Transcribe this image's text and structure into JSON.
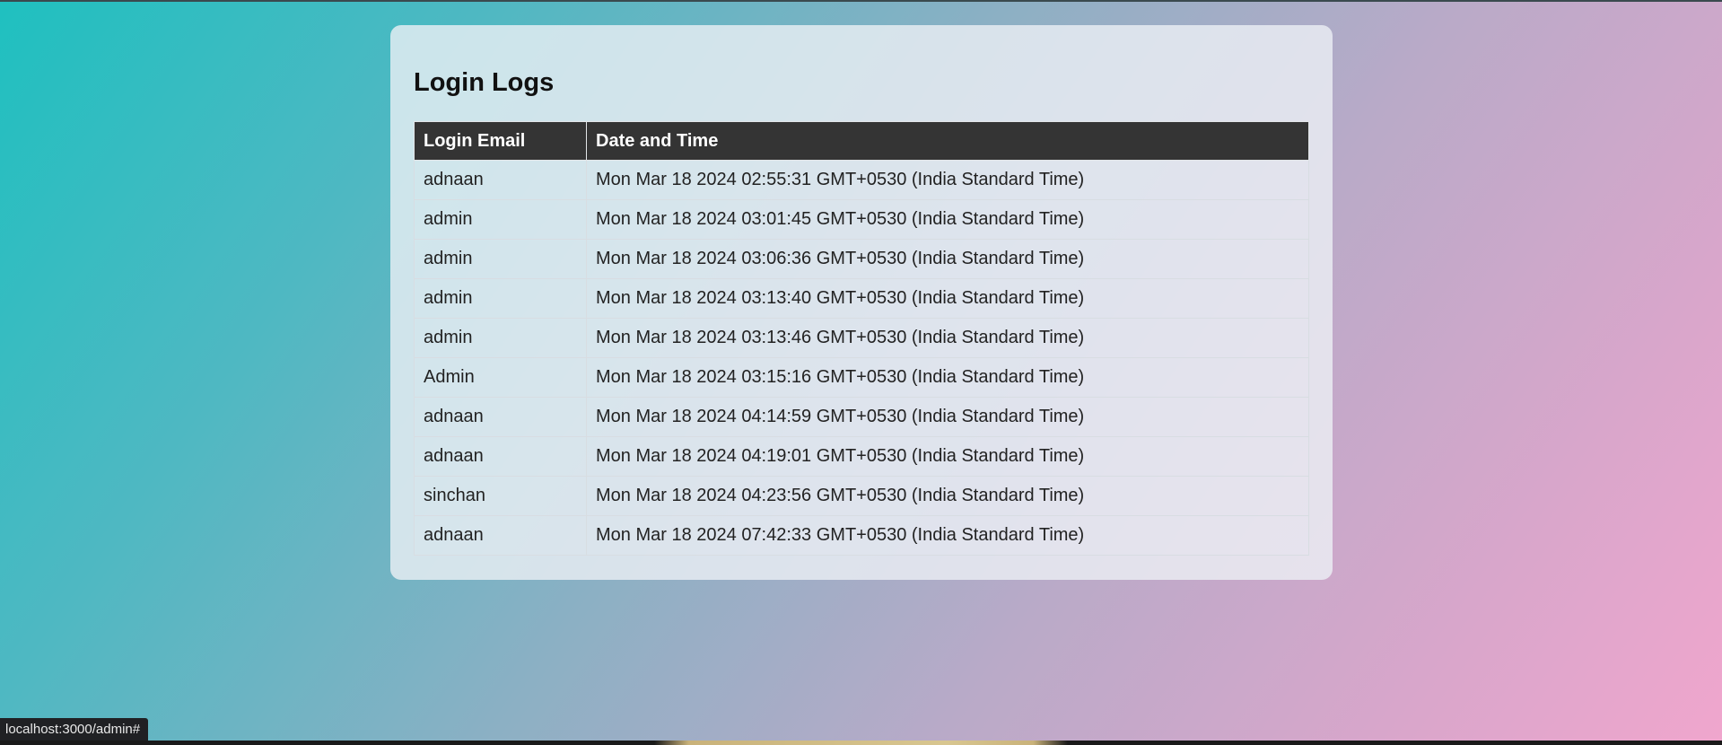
{
  "page": {
    "title": "Login Logs"
  },
  "table": {
    "headers": {
      "email": "Login Email",
      "datetime": "Date and Time"
    },
    "rows": [
      {
        "email": "adnaan",
        "datetime": "Mon Mar 18 2024 02:55:31 GMT+0530 (India Standard Time)"
      },
      {
        "email": "admin",
        "datetime": "Mon Mar 18 2024 03:01:45 GMT+0530 (India Standard Time)"
      },
      {
        "email": "admin",
        "datetime": "Mon Mar 18 2024 03:06:36 GMT+0530 (India Standard Time)"
      },
      {
        "email": "admin",
        "datetime": "Mon Mar 18 2024 03:13:40 GMT+0530 (India Standard Time)"
      },
      {
        "email": "admin",
        "datetime": "Mon Mar 18 2024 03:13:46 GMT+0530 (India Standard Time)"
      },
      {
        "email": "Admin",
        "datetime": "Mon Mar 18 2024 03:15:16 GMT+0530 (India Standard Time)"
      },
      {
        "email": "adnaan",
        "datetime": "Mon Mar 18 2024 04:14:59 GMT+0530 (India Standard Time)"
      },
      {
        "email": "adnaan",
        "datetime": "Mon Mar 18 2024 04:19:01 GMT+0530 (India Standard Time)"
      },
      {
        "email": "sinchan",
        "datetime": "Mon Mar 18 2024 04:23:56 GMT+0530 (India Standard Time)"
      },
      {
        "email": "adnaan",
        "datetime": "Mon Mar 18 2024 07:42:33 GMT+0530 (India Standard Time)"
      }
    ]
  },
  "status_bar": {
    "url": "localhost:3000/admin#"
  },
  "colors": {
    "header_bg": "#343434",
    "header_text": "#ffffff",
    "gradient_start": "#1fc0c0",
    "gradient_end": "#f0a6cd"
  }
}
